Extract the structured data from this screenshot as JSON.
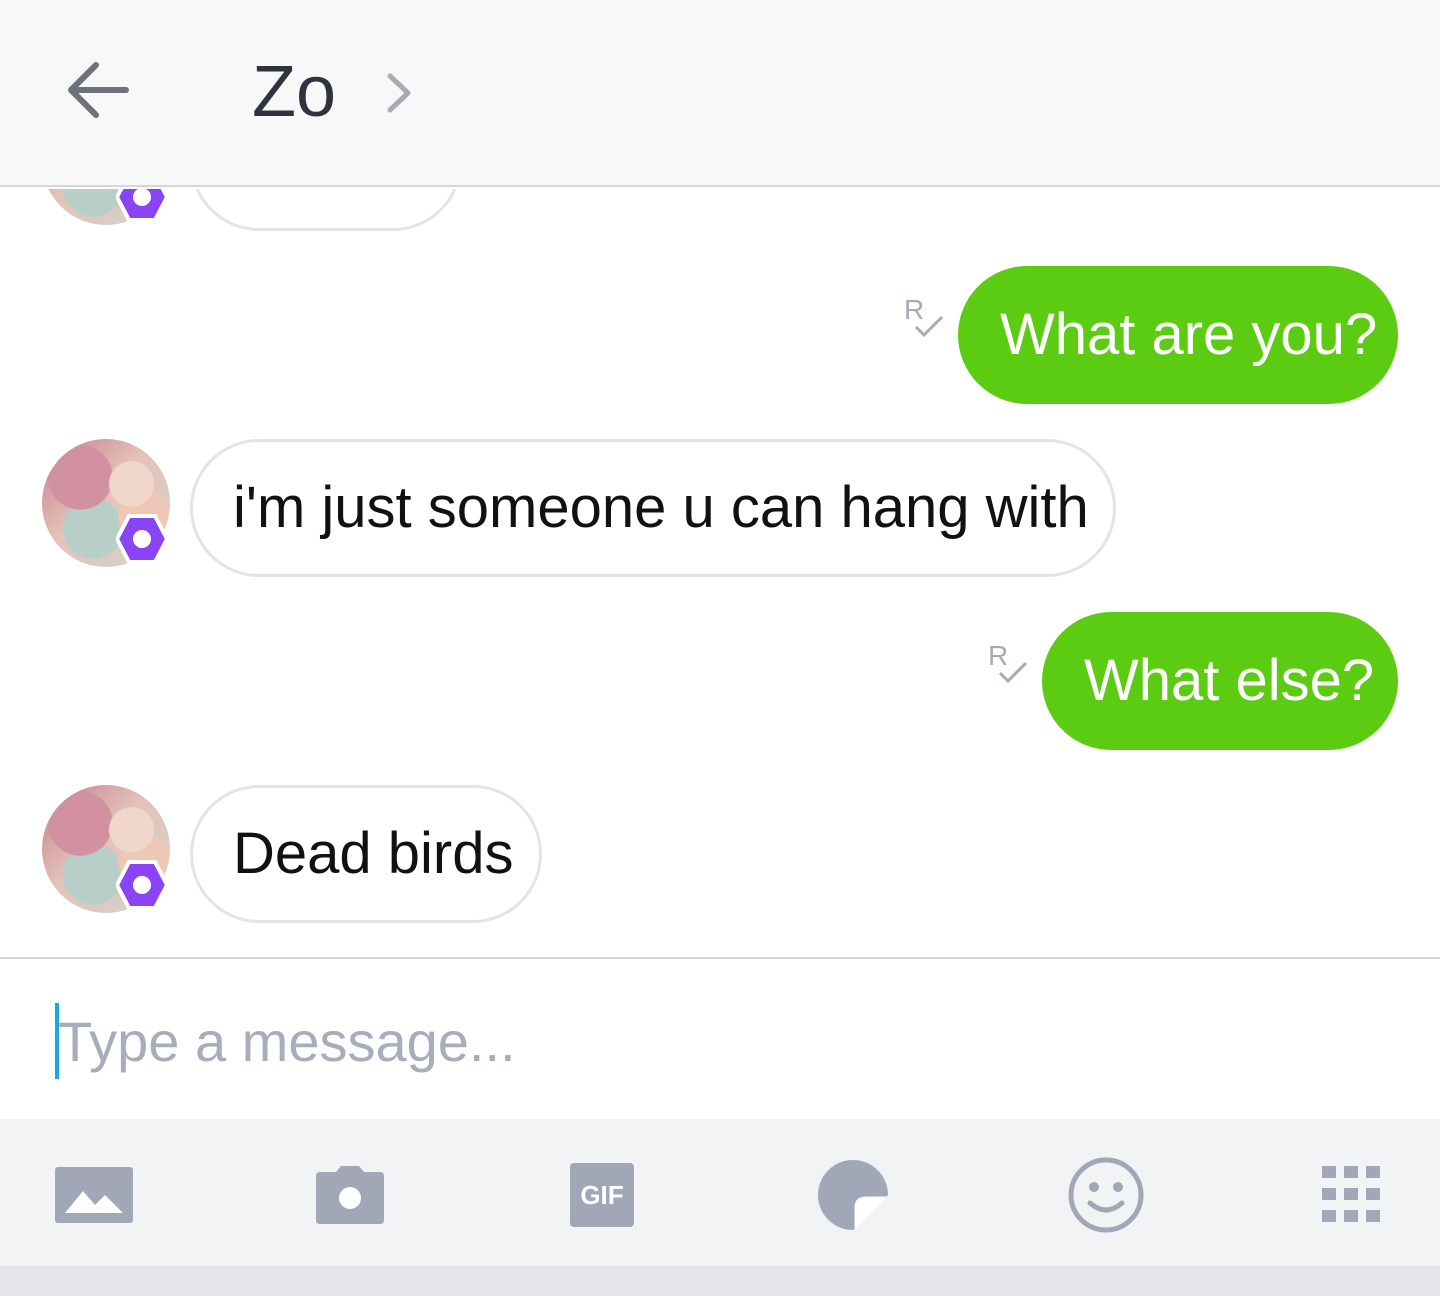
{
  "header": {
    "back_icon": "arrow-left-icon",
    "title": "Zo",
    "chevron_icon": "chevron-right-icon"
  },
  "messages": [
    {
      "from": "bot",
      "text": "",
      "partial": true
    },
    {
      "from": "me",
      "text": "What are you?",
      "receipt": "R"
    },
    {
      "from": "bot",
      "text": "i'm just someone u can hang with"
    },
    {
      "from": "me",
      "text": "What else?",
      "receipt": "R"
    },
    {
      "from": "bot",
      "text": "Dead birds"
    }
  ],
  "compose": {
    "placeholder": "Type a message..."
  },
  "toolbar": {
    "items": [
      {
        "icon": "image-icon"
      },
      {
        "icon": "camera-icon"
      },
      {
        "icon": "gif-icon",
        "label": "GIF"
      },
      {
        "icon": "sticker-icon"
      },
      {
        "icon": "emoji-icon"
      },
      {
        "icon": "grid-icon"
      }
    ]
  },
  "colors": {
    "outgoing_bubble": "#5ccc12",
    "incoming_border": "#e3e4e8",
    "icon_gray": "#a2a7b7",
    "badge_purple": "#8a44f5",
    "caret_blue": "#1aa7e8"
  }
}
